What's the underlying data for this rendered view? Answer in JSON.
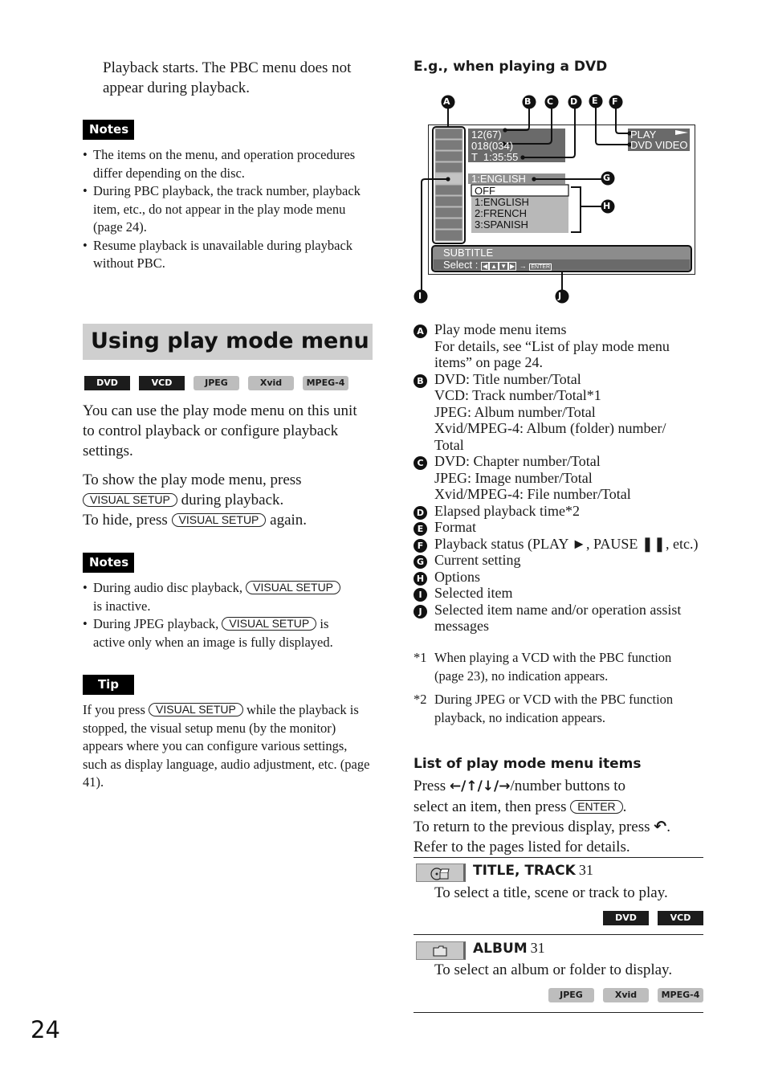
{
  "page_number": "24",
  "left": {
    "intro_text": "Playback starts. The PBC menu does not appear during playback.",
    "notes1": {
      "label": "Notes",
      "items": [
        "The items on the menu, and operation procedures differ depending on the disc.",
        "During PBC playback, the track number, playback item, etc., do not appear in the play mode menu (page 24).",
        "Resume playback is unavailable during playback without PBC."
      ]
    },
    "section_title": "Using play mode menu",
    "badges": [
      {
        "label": "DVD",
        "style": "dark"
      },
      {
        "label": "VCD",
        "style": "dark"
      },
      {
        "label": "JPEG",
        "style": "light"
      },
      {
        "label": "Xvid",
        "style": "light"
      },
      {
        "label": "MPEG-4",
        "style": "light"
      }
    ],
    "para1": "You can use the play mode menu on this unit to control playback or configure playback settings.",
    "para2": {
      "line1": "To show the play mode menu, press",
      "button": "VISUAL SETUP",
      "line2_after": "during playback.",
      "line3_before": "To hide, press",
      "line3_after": "again."
    },
    "notes2": {
      "label": "Notes",
      "item1_before": "During audio disc playback,",
      "item1_button": "VISUAL SETUP",
      "item1_after": "is inactive.",
      "item2_before": "During JPEG playback,",
      "item2_button": "VISUAL SETUP",
      "item2_after": "is",
      "item2_line2": "active only when an image is fully displayed."
    },
    "tip": {
      "label": "Tip",
      "before": "If you press",
      "button": "VISUAL SETUP",
      "after": "while the playback",
      "rest": "is stopped, the visual setup menu (by the monitor) appears where you can configure various settings, such as display language, audio adjustment, etc. (page 41)."
    }
  },
  "right": {
    "example_heading": "E.g., when playing a DVD",
    "diagram": {
      "callouts": [
        "A",
        "B",
        "C",
        "D",
        "E",
        "F",
        "G",
        "H",
        "I",
        "J"
      ],
      "info_lines": [
        "12(67)",
        "018(034)",
        "T  1:35:55"
      ],
      "status_lines": [
        "PLAY",
        "DVD VIDEO"
      ],
      "current_setting": "1:ENGLISH",
      "options": [
        "OFF",
        "1:ENGLISH",
        "2:FRENCH",
        "3:SPANISH"
      ],
      "bottom_title": "SUBTITLE",
      "bottom_help": "Select :",
      "bottom_enter": "ENTER"
    },
    "legend": [
      {
        "mark": "A",
        "lines": [
          "Play mode menu items",
          "For details, see “List of play mode menu",
          "items” on page 24."
        ]
      },
      {
        "mark": "B",
        "lines": [
          "DVD: Title number/Total",
          "VCD: Track number/Total*1",
          "JPEG: Album number/Total",
          "Xvid/MPEG-4: Album (folder) number/",
          "Total"
        ]
      },
      {
        "mark": "C",
        "lines": [
          "DVD: Chapter number/Total",
          "JPEG: Image number/Total",
          "Xvid/MPEG-4: File number/Total"
        ]
      },
      {
        "mark": "D",
        "lines": [
          "Elapsed playback time*2"
        ]
      },
      {
        "mark": "E",
        "lines": [
          "Format"
        ]
      },
      {
        "mark": "F",
        "lines": [
          "Playback status (PLAY ►, PAUSE ❚❚, etc.)"
        ]
      },
      {
        "mark": "G",
        "lines": [
          "Current setting"
        ]
      },
      {
        "mark": "H",
        "lines": [
          "Options"
        ]
      },
      {
        "mark": "I",
        "lines": [
          "Selected item"
        ]
      },
      {
        "mark": "J",
        "lines": [
          "Selected item name and/or operation assist",
          "messages"
        ]
      }
    ],
    "footnotes": [
      {
        "mark": "*1",
        "text": "When playing a VCD with the PBC function (page 23), no indication appears."
      },
      {
        "mark": "*2",
        "text": "During JPEG or VCD with the PBC function playback, no indication appears."
      }
    ],
    "list_heading": "List of play mode menu items",
    "list_intro": {
      "press": "Press",
      "arrows": "←/↑/↓/→",
      "after_arrows": "/number buttons to",
      "line2_before": "select an item, then press",
      "enter_button": "ENTER",
      "line3": "To return to the previous display, press",
      "return_icon": "↶",
      "line4": "Refer to the pages listed for details."
    },
    "menu_items": [
      {
        "icon": "disc-clapper-icon",
        "title": "TITLE, TRACK",
        "page": "31",
        "desc": "To select a title, scene or track to play.",
        "badges": [
          {
            "label": "DVD",
            "style": "dark"
          },
          {
            "label": "VCD",
            "style": "dark"
          }
        ]
      },
      {
        "icon": "folder-icon",
        "title": "ALBUM",
        "page": "31",
        "desc": "To select an album or folder to display.",
        "badges": [
          {
            "label": "JPEG",
            "style": "light"
          },
          {
            "label": "Xvid",
            "style": "light"
          },
          {
            "label": "MPEG-4",
            "style": "light"
          }
        ]
      }
    ]
  }
}
